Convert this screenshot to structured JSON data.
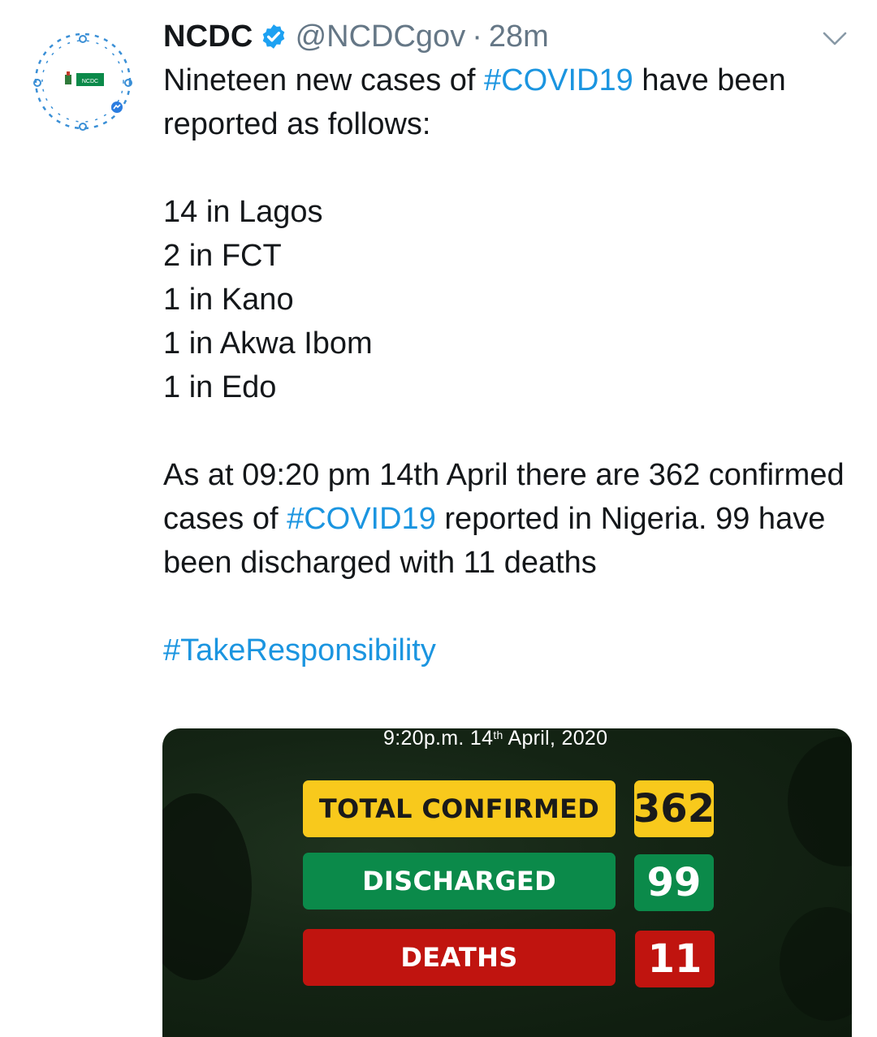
{
  "tweet": {
    "author_name": "NCDC",
    "handle": "@NCDCgov",
    "separator": "·",
    "time_ago": "28m",
    "lines": {
      "intro_pre": "Nineteen new cases of ",
      "intro_hashtag": "#COVID19",
      "intro_post": " have been reported as follows:",
      "case_1": "14 in Lagos",
      "case_2": "2 in FCT",
      "case_3": "1 in Kano",
      "case_4": "1 in Akwa Ibom",
      "case_5": "1 in Edo",
      "summary_pre": "As at 09:20 pm 14th April there are 362 confirmed cases of ",
      "summary_hashtag": "#COVID19",
      "summary_post": " reported in Nigeria. 99 have been discharged with 11 deaths",
      "closing_hashtag": "#TakeResponsibility"
    },
    "avatar_logo_text": "NCDC"
  },
  "media": {
    "date_prefix": "9:20p.m. 14",
    "date_sup": "th",
    "date_suffix": " April, 2020",
    "stats": {
      "total_confirmed_label": "TOTAL CONFIRMED",
      "total_confirmed_value": "362",
      "discharged_label": "DISCHARGED",
      "discharged_value": "99",
      "deaths_label": "DEATHS",
      "deaths_value": "11"
    }
  },
  "icons": {
    "verified": "verified-badge-icon",
    "menu": "chevron-down-icon"
  },
  "colors": {
    "hashtag": "#1b95e0",
    "verified": "#1da1f2",
    "confirmed": "#f8c91c",
    "discharged": "#0b8a4a",
    "deaths": "#c0140f"
  }
}
